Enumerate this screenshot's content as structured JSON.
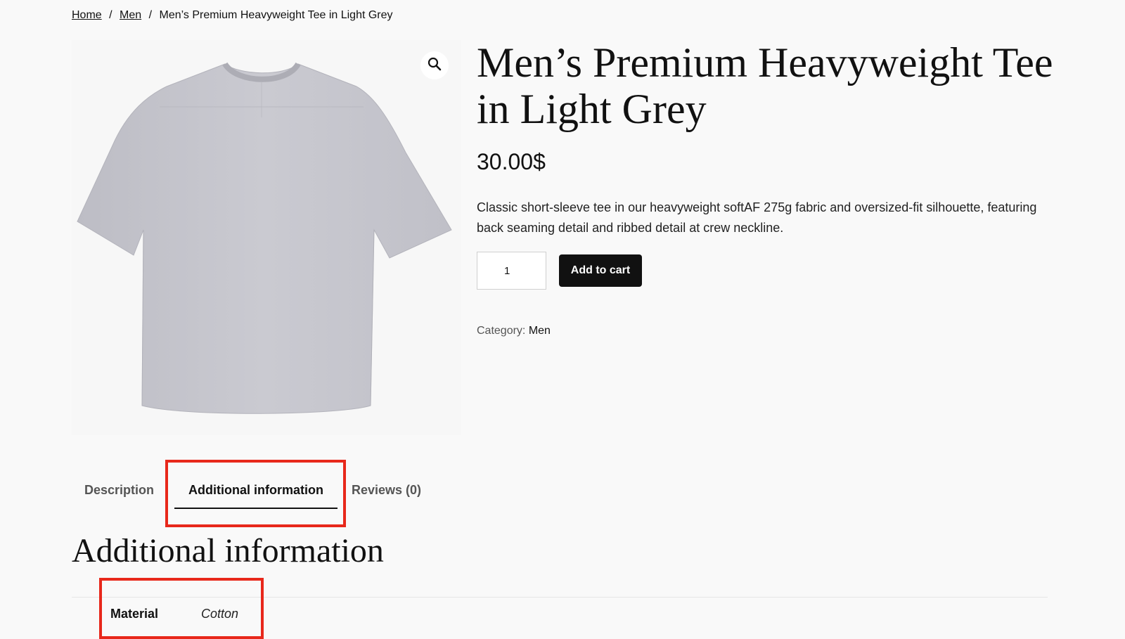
{
  "breadcrumb": {
    "home": "Home",
    "category": "Men",
    "current": "Men’s Premium Heavyweight Tee in Light Grey",
    "separator": "/"
  },
  "product": {
    "title": "Men’s Premium Heavyweight Tee in Light Grey",
    "price": "30.00$",
    "short_description": "Classic short-sleeve tee in our heavyweight softAF 275g fabric and oversized-fit silhouette, featuring back seaming detail and ribbed detail at crew neckline.",
    "quantity": "1",
    "add_to_cart_label": "Add to cart",
    "category_label": "Category:",
    "category_value": "Men",
    "image_color": "#c8c8cf"
  },
  "tabs": [
    {
      "label": "Description",
      "active": false
    },
    {
      "label": "Additional information",
      "active": true
    },
    {
      "label": "Reviews (0)",
      "active": false
    }
  ],
  "additional_info": {
    "heading": "Additional information",
    "rows": [
      {
        "label": "Material",
        "value": "Cotton"
      }
    ]
  },
  "colors": {
    "highlight": "#e8281b",
    "button_bg": "#111111",
    "page_bg": "#f9f9f9"
  },
  "icons": {
    "zoom": "magnifier-icon"
  }
}
